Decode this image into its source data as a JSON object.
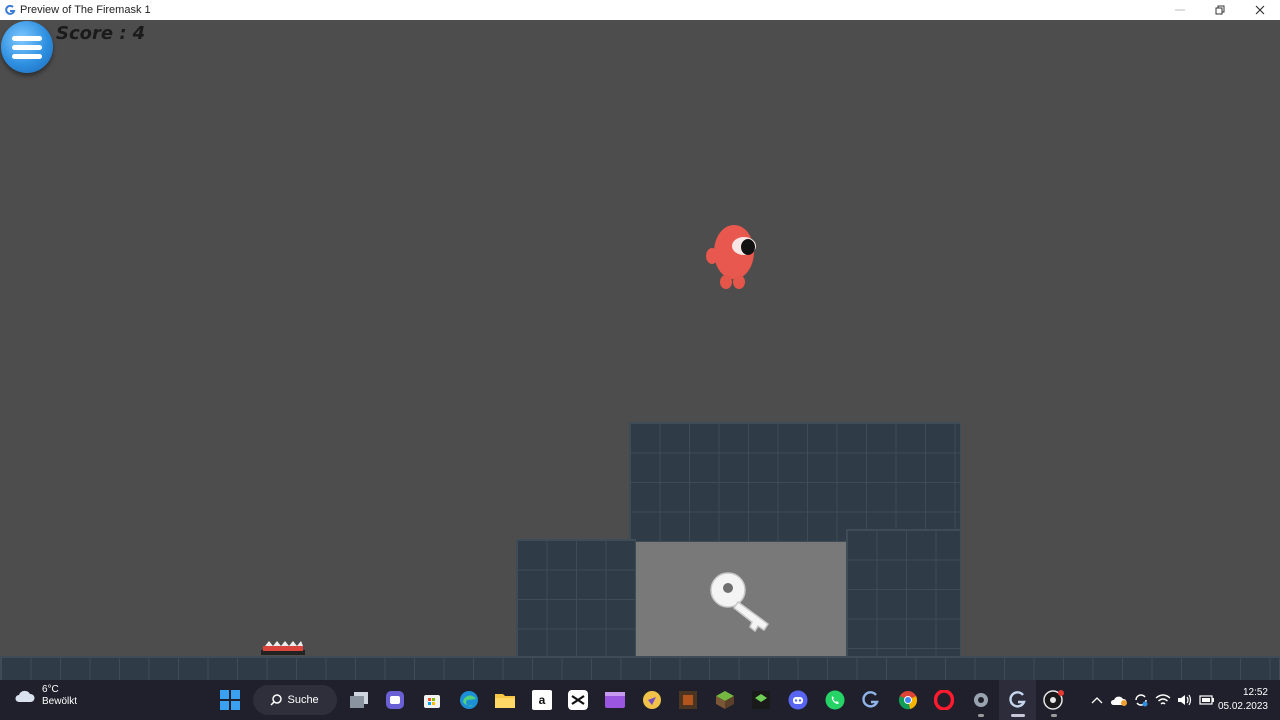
{
  "window": {
    "title": "Preview of The Firemask 1"
  },
  "hud": {
    "score_label": "Score :",
    "score_value": "4",
    "menu_icon": "hamburger-menu-icon"
  },
  "game": {
    "player": "red-one-eyed-creature",
    "pickup": "key-icon",
    "hazard": "spike-trap"
  },
  "taskbar": {
    "weather_temp": "6°C",
    "weather_desc": "Bewölkt",
    "search_label": "Suche",
    "apps": [
      "windows-start-icon",
      "search",
      "task-view-icon",
      "chat-icon",
      "store-icon",
      "edge-icon",
      "file-explorer-icon",
      "amazon-icon",
      "capcut-icon",
      "video-editor-icon",
      "browser-icon",
      "minecraft-dungeons-icon",
      "minecraft-icon",
      "minecraft-launcher-icon",
      "discord-icon",
      "whatsapp-icon",
      "gdevelop-icon",
      "chrome-icon",
      "opera-icon",
      "settings-icon",
      "gdevelop-preview-icon",
      "obs-icon"
    ],
    "clock_time": "12:52",
    "clock_date": "05.02.2023"
  },
  "colors": {
    "background": "#4d4d4d",
    "tile": "#2f3b46",
    "cave": "#797979",
    "player": "#e8584e",
    "menu_button": "#2e8fe0"
  }
}
